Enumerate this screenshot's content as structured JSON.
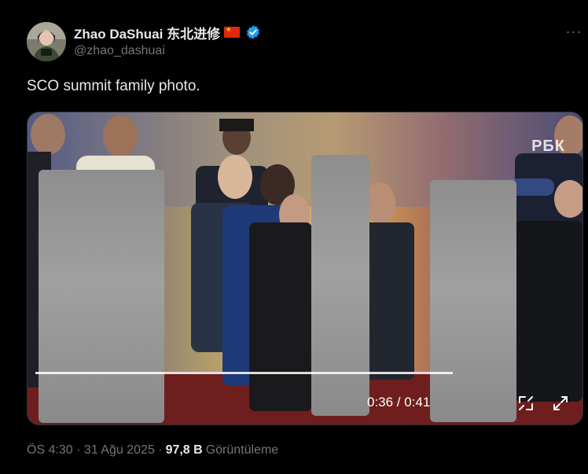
{
  "author": {
    "display_name": "Zhao DaShuai 东北进修",
    "handle": "@zhao_dashuai",
    "flag_icon": "china-flag-icon",
    "verified_icon": "verified-badge-icon",
    "verified_color": "#1d9bf0"
  },
  "tweet": {
    "text": "SCO summit family photo."
  },
  "video": {
    "watermark": "РБК",
    "time_display": "0:36 / 0:41",
    "progress": 0.87,
    "controls": [
      "theater-mode-icon",
      "fullscreen-icon"
    ]
  },
  "footer": {
    "time": "ÖS 4:30 · 31 Ağu 2025 · ",
    "views_count": "97,8 B",
    "views_label": "Görüntüleme"
  },
  "colors": {
    "background": "#000000",
    "text_primary": "#e7e9ea",
    "text_secondary": "#71767b",
    "border": "#2f3336"
  }
}
